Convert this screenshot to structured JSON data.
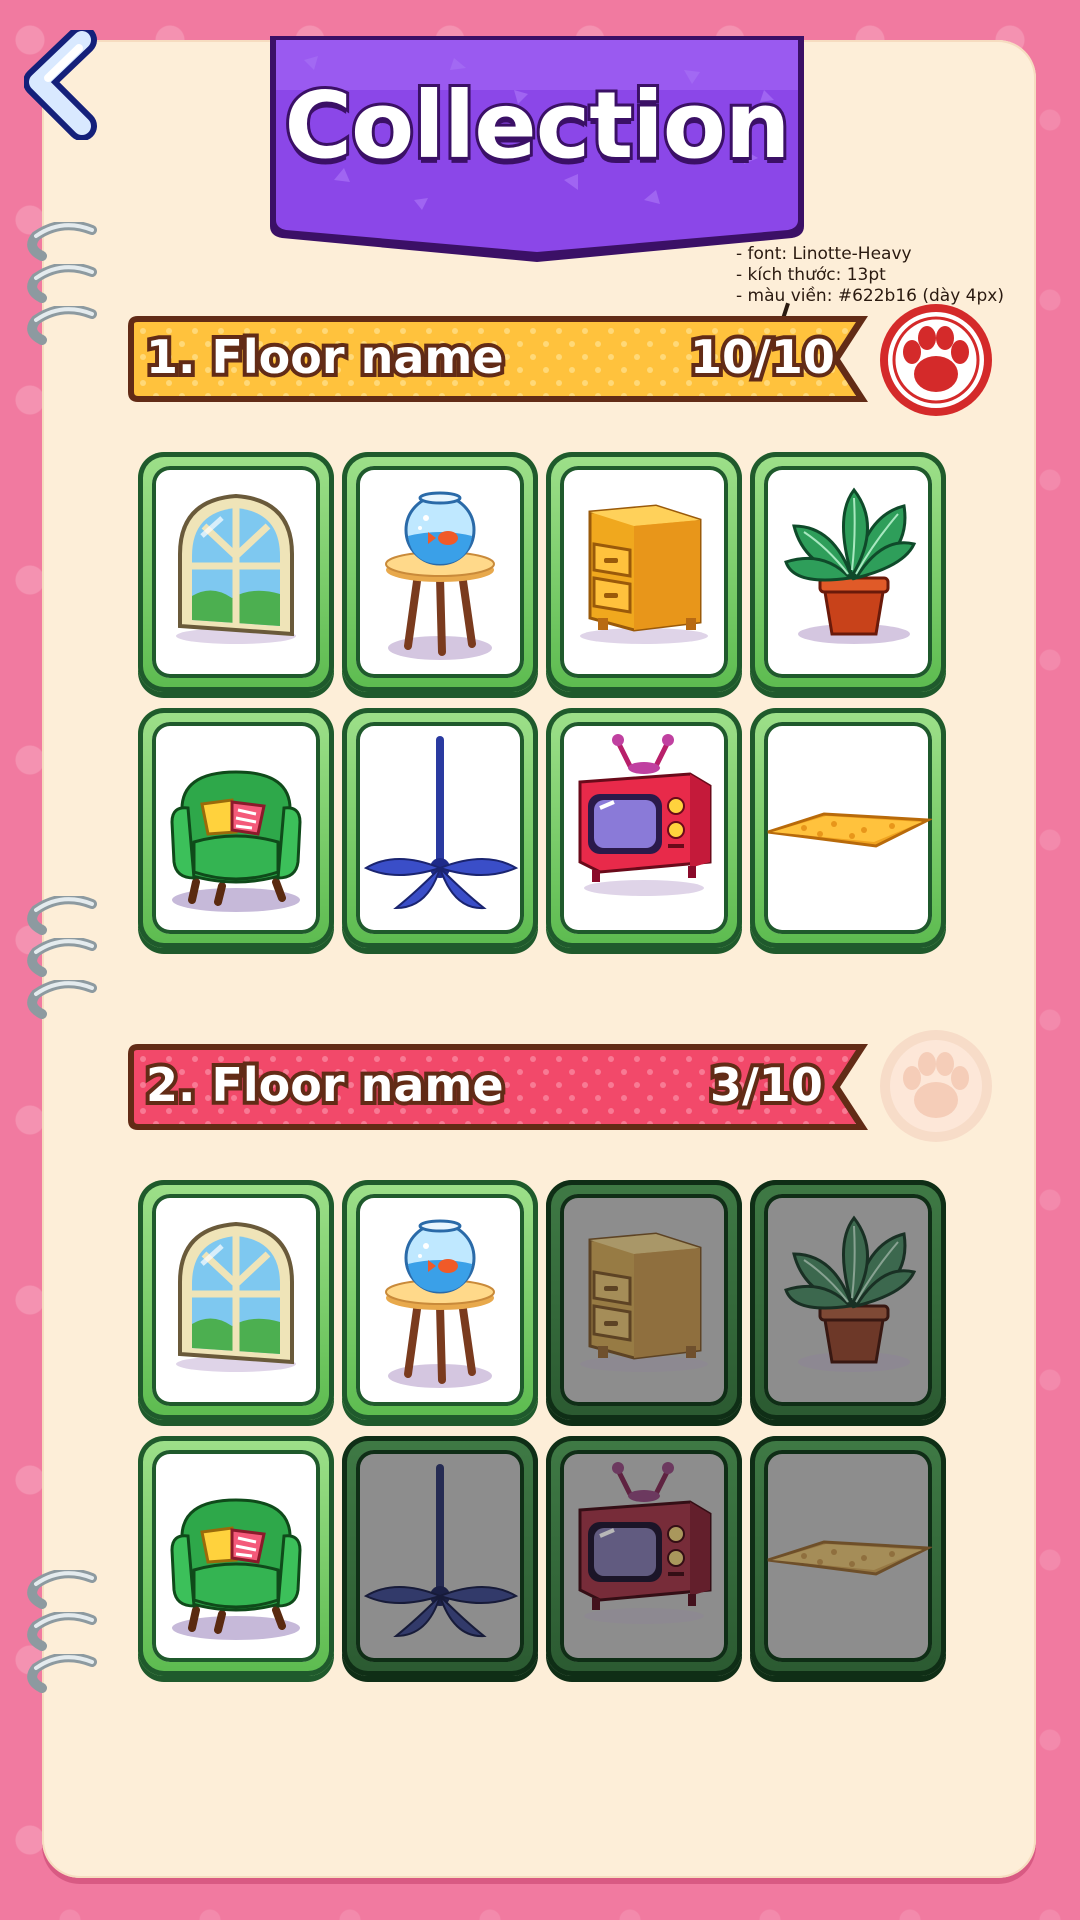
{
  "header": {
    "title": "Collection",
    "back_icon": "chevron-left-icon"
  },
  "annotation": {
    "font_line": "- font: Linotte-Heavy",
    "size_line": "- kích thước: 13pt",
    "stroke_line": "- màu viền: #622b16 (dày 4px)"
  },
  "floors": [
    {
      "name": "1. Floor name",
      "progress": "10/10",
      "collected": 10,
      "total": 10,
      "ribbon_color": "#ffc23d",
      "paw_state": "active",
      "items": [
        {
          "icon": "window-icon",
          "unlocked": true
        },
        {
          "icon": "fishbowl-table-icon",
          "unlocked": true
        },
        {
          "icon": "drawer-cabinet-icon",
          "unlocked": true
        },
        {
          "icon": "potted-plant-icon",
          "unlocked": true
        },
        {
          "icon": "armchair-icon",
          "unlocked": true
        },
        {
          "icon": "ceiling-fan-icon",
          "unlocked": true
        },
        {
          "icon": "retro-tv-icon",
          "unlocked": true
        },
        {
          "icon": "rug-icon",
          "unlocked": true
        }
      ]
    },
    {
      "name": "2. Floor name",
      "progress": "3/10",
      "collected": 3,
      "total": 10,
      "ribbon_color": "#f2496a",
      "paw_state": "inactive",
      "items": [
        {
          "icon": "window-icon",
          "unlocked": true
        },
        {
          "icon": "fishbowl-table-icon",
          "unlocked": true
        },
        {
          "icon": "drawer-cabinet-icon",
          "unlocked": false
        },
        {
          "icon": "potted-plant-icon",
          "unlocked": false
        },
        {
          "icon": "armchair-icon",
          "unlocked": true
        },
        {
          "icon": "ceiling-fan-icon",
          "unlocked": false
        },
        {
          "icon": "retro-tv-icon",
          "unlocked": false
        },
        {
          "icon": "rug-icon",
          "unlocked": false
        }
      ]
    }
  ],
  "colors": {
    "frame": "#f17aa0",
    "paper": "#fdeed8",
    "banner": "#8b47e8",
    "text_stroke": "#622b16",
    "paw_active": "#d42a2a"
  }
}
